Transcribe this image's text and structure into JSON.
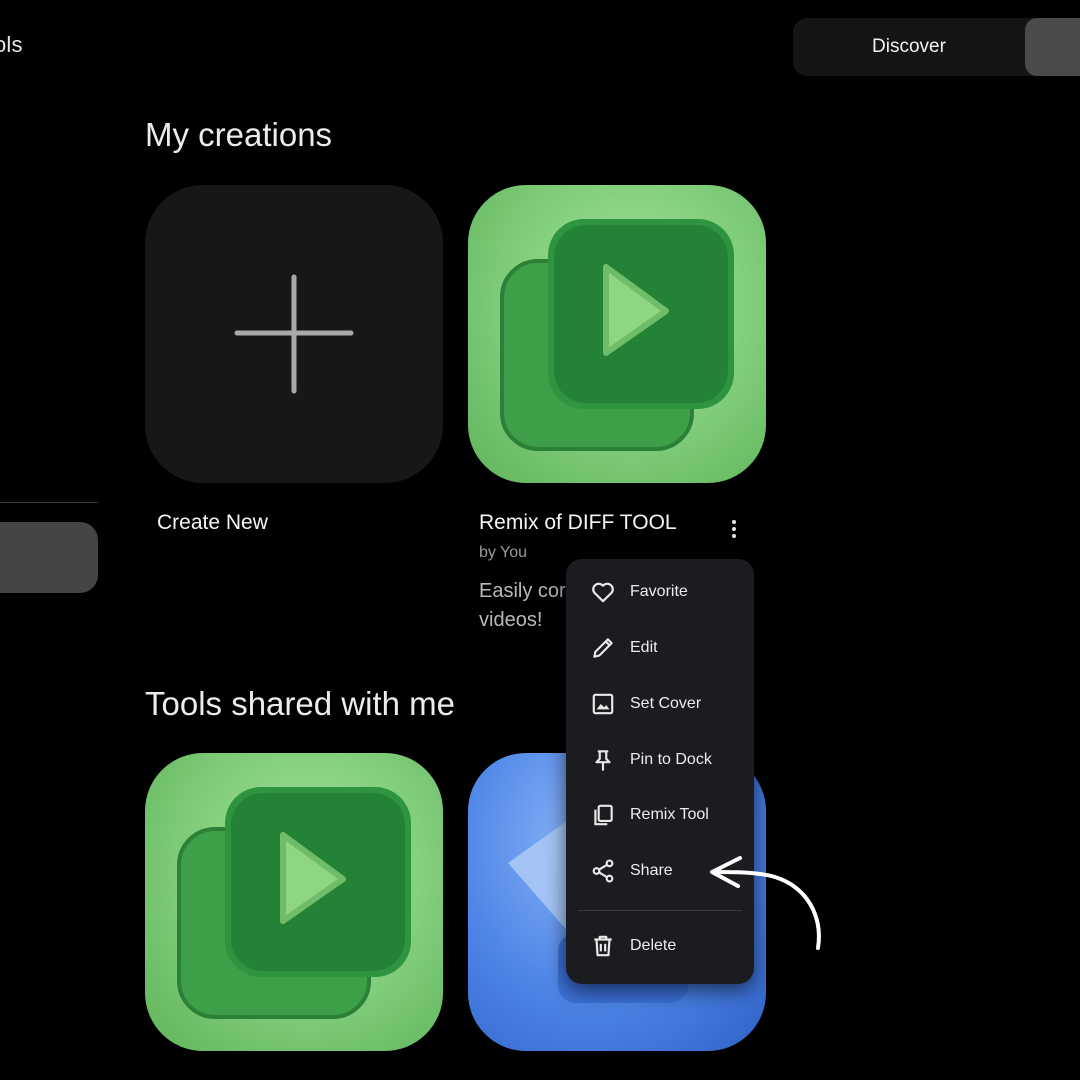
{
  "header": {
    "title": "ols"
  },
  "tabs": {
    "discover_label": "Discover"
  },
  "sections": {
    "my_creations_title": "My creations",
    "shared_title": "Tools shared with me"
  },
  "cards": {
    "create": {
      "label": "Create New"
    },
    "remix": {
      "title": "Remix of DIFF TOOL",
      "author": "by You",
      "description_line1": "Easily cor",
      "description_line2": "videos!"
    }
  },
  "menu": {
    "items": [
      {
        "label": "Favorite",
        "icon": "heart-icon"
      },
      {
        "label": "Edit",
        "icon": "pencil-icon"
      },
      {
        "label": "Set Cover",
        "icon": "image-icon"
      },
      {
        "label": "Pin to Dock",
        "icon": "pin-icon"
      },
      {
        "label": "Remix Tool",
        "icon": "copy-icon"
      },
      {
        "label": "Share",
        "icon": "share-icon"
      },
      {
        "label": "Delete",
        "icon": "trash-icon"
      }
    ]
  },
  "colors": {
    "background": "#000000",
    "menu_bg": "#1b1c1f",
    "green_tile": "#86d180",
    "blue_tile": "#4f86e8"
  }
}
